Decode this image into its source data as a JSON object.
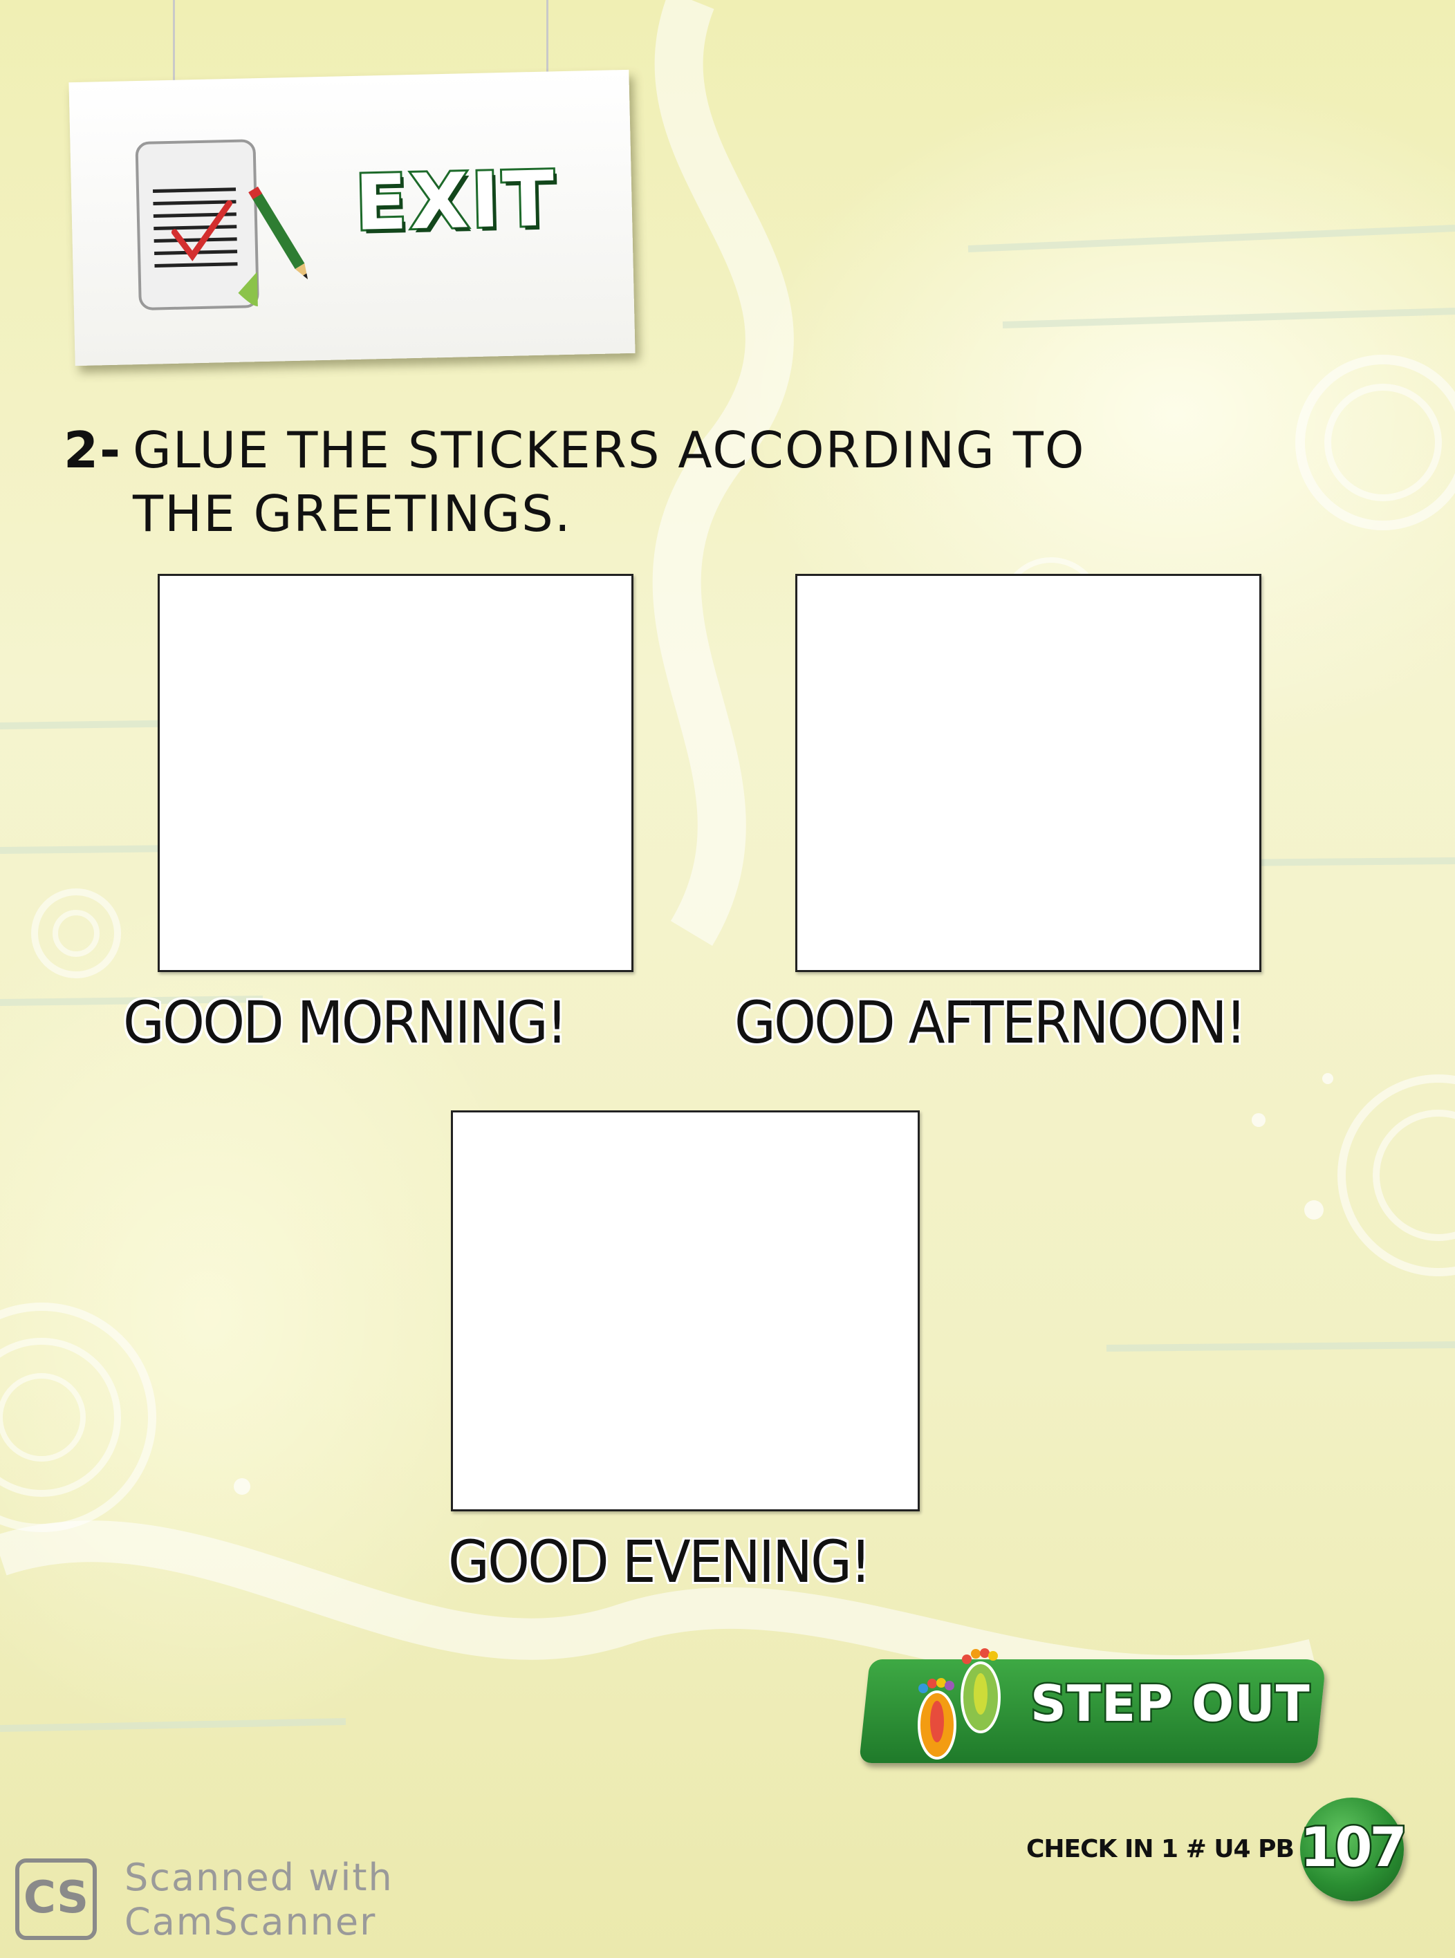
{
  "header": {
    "icon": "checklist-document-icon",
    "title": "EXIT"
  },
  "instruction": {
    "number": "2-",
    "line1": "GLUE THE STICKERS ACCORDING TO",
    "line2": "THE GREETINGS."
  },
  "boxes": [
    {
      "label": "GOOD MORNING!"
    },
    {
      "label": "GOOD AFTERNOON!"
    },
    {
      "label": "GOOD EVENING!"
    }
  ],
  "stepout": {
    "icon": "footprints-icon",
    "label": "STEP OUT"
  },
  "footer": {
    "code": "CHECK IN 1 # U4 PB",
    "page_number": "107"
  },
  "watermark": {
    "logo": "CS",
    "line1": "Scanned with",
    "line2": "CamScanner"
  },
  "colors": {
    "background": "#f4f3c8",
    "accent_green": "#1f7a2a"
  }
}
